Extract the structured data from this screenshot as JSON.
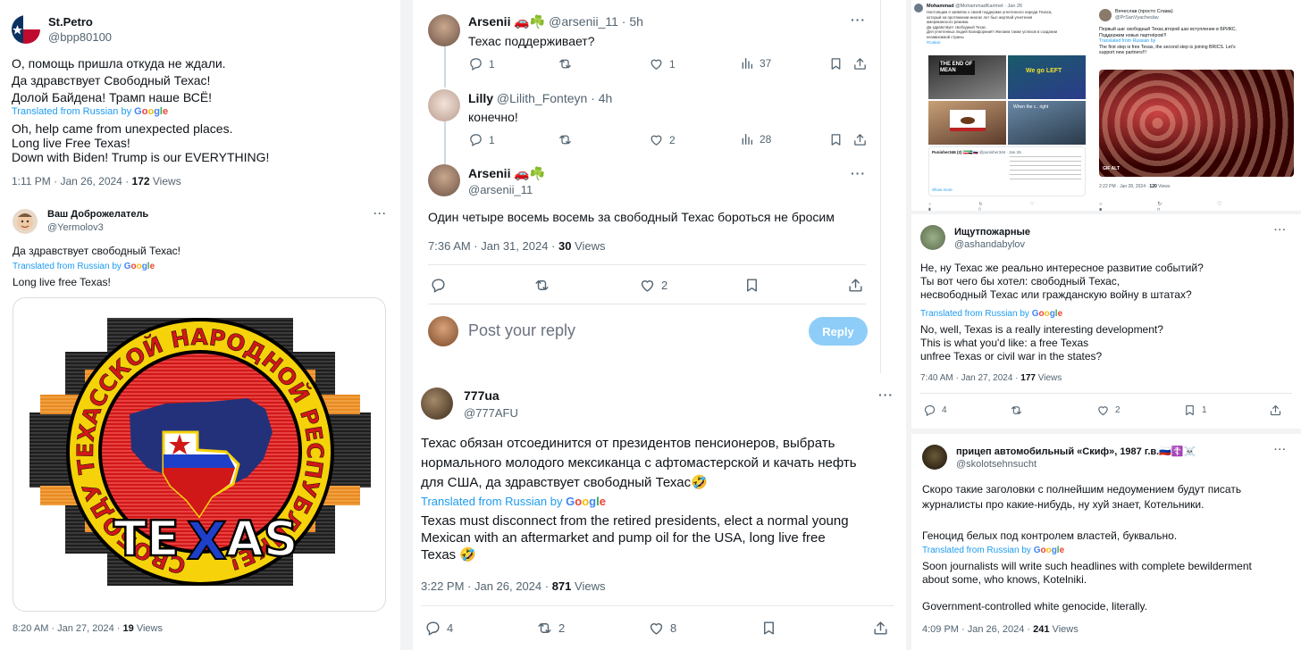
{
  "p1": {
    "name": "St.Petro",
    "handle": "@bpp80100",
    "orig": [
      "О, помощь пришла откуда не ждали.",
      "Да здравствует Свободный Техас!",
      "Долой Байдена! Трамп наше ВСЁ!"
    ],
    "translated": "Translated from Russian by",
    "trans": [
      "Oh, help came from unexpected places.",
      "Long live Free Texas!",
      "Down with Biden! Trump is our EVERYTHING!"
    ],
    "time": "1:11 PM · Jan 26, 2024 · ",
    "views_n": "172",
    "views_l": " Views"
  },
  "p2": {
    "name": "Ваш Доброжелатель",
    "handle": "@Yermolov3",
    "orig": "Да здравствует свободный Техас!",
    "translated": "Translated from Russian by",
    "trans": "Long live free Texas!",
    "logo_ring": "СВОБОДУ ТЕХАССКОЙ НАРОДНОЙ РЕСПУБЛИКЕ!",
    "logo_word_a": "TE",
    "logo_word_x": "X",
    "logo_word_b": "AS",
    "time": "8:20 AM · Jan 27, 2024 · ",
    "views_n": "19",
    "views_l": " Views"
  },
  "p3": {
    "r1": {
      "name": "Arsenii",
      "emoji": "🚗☘️",
      "handle": "@arsenii_11",
      "age": "· 5h",
      "text": "Техас поддерживает?",
      "replies": "1",
      "likes": "1",
      "views": "37"
    },
    "r2": {
      "name": "Lilly",
      "handle": "@Lilith_Fonteyn",
      "age": "· 4h",
      "text": "конечно!",
      "replies": "1",
      "likes": "2",
      "views": "28"
    },
    "main": {
      "name": "Arsenii",
      "emoji": "🚗☘️",
      "handle": "@arsenii_11",
      "text": "Один четыре восемь восемь за свободный Техас бороться не бросим",
      "time": "7:36 AM · Jan 31, 2024 · ",
      "views_n": "30",
      "views_l": " Views",
      "likes": "2"
    },
    "reply_placeholder": "Post your reply",
    "reply_btn": "Reply"
  },
  "p4": {
    "name": "777ua",
    "handle": "@777AFU",
    "orig": [
      "Техас обязан отсоединится от президентов пенсионеров, выбрать",
      "нормального молодого мексиканца с афтомастерской и качать нефть",
      "для США, да здравствует свободный Техас🤣"
    ],
    "translated": "Translated from Russian by",
    "trans": [
      "Texas must disconnect from the retired presidents, elect a normal young",
      "Mexican with an aftermarket and pump oil for the USA, long live free",
      "Texas 🤣"
    ],
    "time": "3:22 PM · Jan 26, 2024 · ",
    "views_n": "871",
    "views_l": " Views",
    "replies": "4",
    "reposts": "2",
    "likes": "8"
  },
  "p5": {
    "left": {
      "name": "Mohammad",
      "handle": "@MohammadKarimet · Jan 26",
      "show_more": "Show more",
      "text": [
        "Настоящим я заявляю о своей поддержке угнетенного народа Техаса,",
        "который на протяжении многих лет был жертвой угнетения",
        "американского режима.",
        "Да здравствует свободный Техас.",
        "Для угнетенных людей Калифорнии!!! Желаем также успехов в создании",
        "независимой страны",
        "#Calexit"
      ],
      "inner": {
        "name": "Punisher346 (2) 🇮🇷🇸🇾🇷🇺",
        "handle": "@punisher346 · Jan 26"
      },
      "sign1": "THE END OF MEAN",
      "sign2": "We go LEFT",
      "sign3": "When the c.. right"
    },
    "right": {
      "name": "Вячеслав (просто Слава)",
      "handle": "@PrSanVyacheslav",
      "text": [
        "Первый шаг свободный Техас,второй шаг вступление в БРИКС.",
        "Поддержим новых партнёров!!!"
      ],
      "translated": "Translated from Russian by",
      "trans": [
        "The first step is free Texas, the second step is joining BRICS. Let's",
        "support new partners!!!"
      ],
      "gif": "GIF",
      "alt": "ALT",
      "time": "2:22 PM · Jan 28, 2024 · ",
      "views_n": "120",
      "views_l": " Views"
    }
  },
  "p6": {
    "name": "Ищутпожарные",
    "handle": "@ashandabylov",
    "orig": [
      "Не, ну Техас же реально интересное развитие событий?",
      "Ты вот чего бы хотел: свободный Техас,",
      " несвободный Техас или  гражданскую войну в штатах?"
    ],
    "translated": "Translated from Russian by",
    "trans": [
      "No, well, Texas is a really interesting development?",
      "This is what you'd like: a free Texas",
      "unfree Texas or civil war in the states?"
    ],
    "time": "7:40 AM · Jan 27, 2024 · ",
    "views_n": "177",
    "views_l": " Views",
    "replies": "4",
    "likes": "2",
    "bookmarks": "1"
  },
  "p7": {
    "name": "прицеп автомобильный «Скиф», 1987 г.в.",
    "flags": "🇷🇺☦️☠️",
    "handle": "@skolotsehnsucht",
    "orig1": [
      "Скоро такие заголовки с полнейшим недоумением будут писать",
      "журналисты про какие-нибудь, ну хуй знает, Котельники."
    ],
    "orig2": "Геноцид белых под контролем властей, буквально.",
    "translated": "Translated from Russian by",
    "trans1": [
      "Soon journalists will write such headlines with complete bewilderment",
      "about some, who knows, Kotelniki."
    ],
    "trans2": "Government-controlled white genocide, literally.",
    "time": "4:09 PM · Jan 26, 2024 · ",
    "views_n": "241",
    "views_l": " Views"
  },
  "google": [
    "G",
    "o",
    "o",
    "g",
    "l",
    "e"
  ],
  "colors": {
    "blue": "#1d9bf0",
    "muted": "#536471",
    "text": "#0f1419"
  }
}
